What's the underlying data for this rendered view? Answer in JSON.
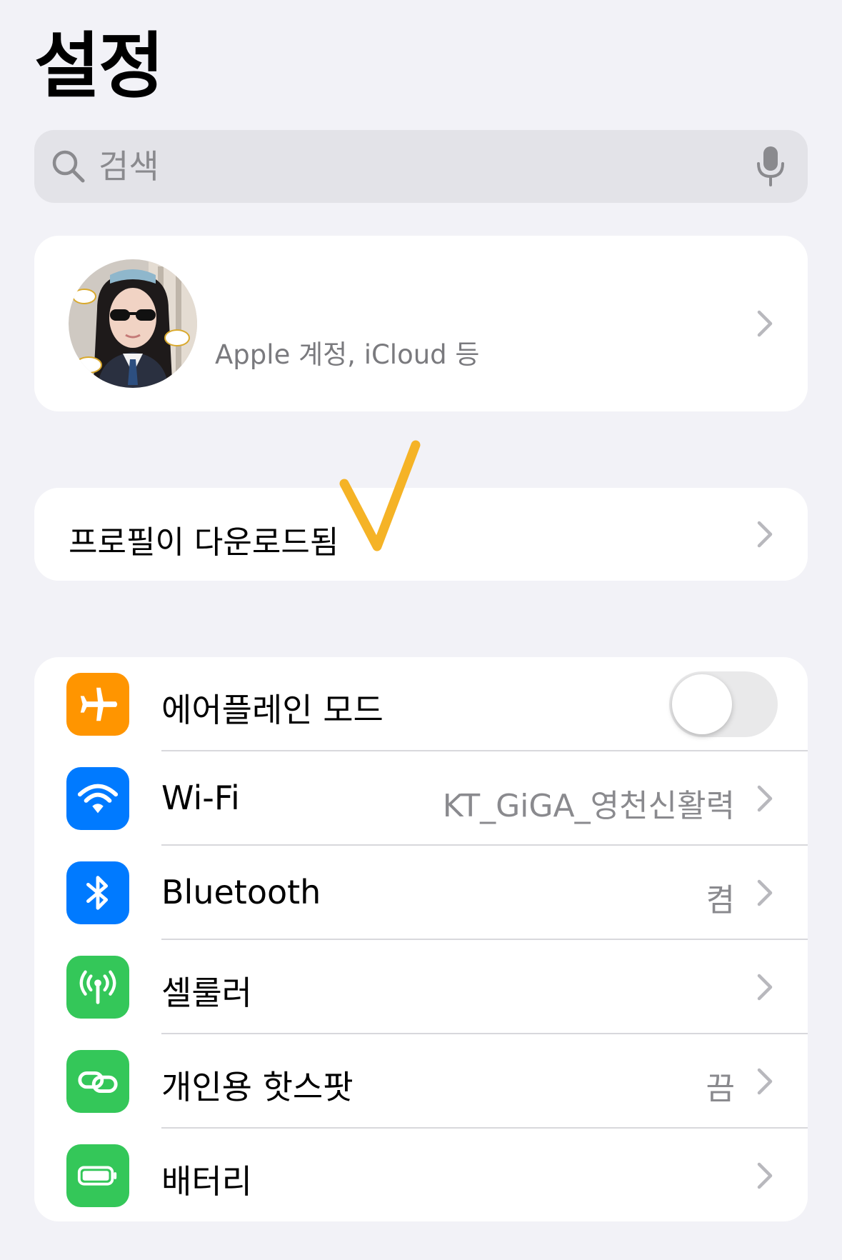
{
  "header": {
    "title": "설정"
  },
  "search": {
    "placeholder": "검색"
  },
  "account": {
    "subtitle": "Apple 계정, iCloud 등"
  },
  "profile_download": {
    "label": "프로필이 다운로드됨"
  },
  "settings": {
    "rows": [
      {
        "label": "에어플레인 모드",
        "icon": "airplane-icon",
        "color": "#ff9500",
        "toggle_on": false
      },
      {
        "label": "Wi-Fi",
        "value": "KT_GiGA_영천신활력",
        "icon": "wifi-icon",
        "color": "#007aff"
      },
      {
        "label": "Bluetooth",
        "value": "켬",
        "icon": "bluetooth-icon",
        "color": "#007aff"
      },
      {
        "label": "셀룰러",
        "icon": "cellular-icon",
        "color": "#34c759"
      },
      {
        "label": "개인용 핫스팟",
        "value": "끔",
        "icon": "hotspot-icon",
        "color": "#34c759"
      },
      {
        "label": "배터리",
        "icon": "battery-icon",
        "color": "#34c759"
      }
    ]
  },
  "annotation": {
    "color": "#f5b326"
  }
}
